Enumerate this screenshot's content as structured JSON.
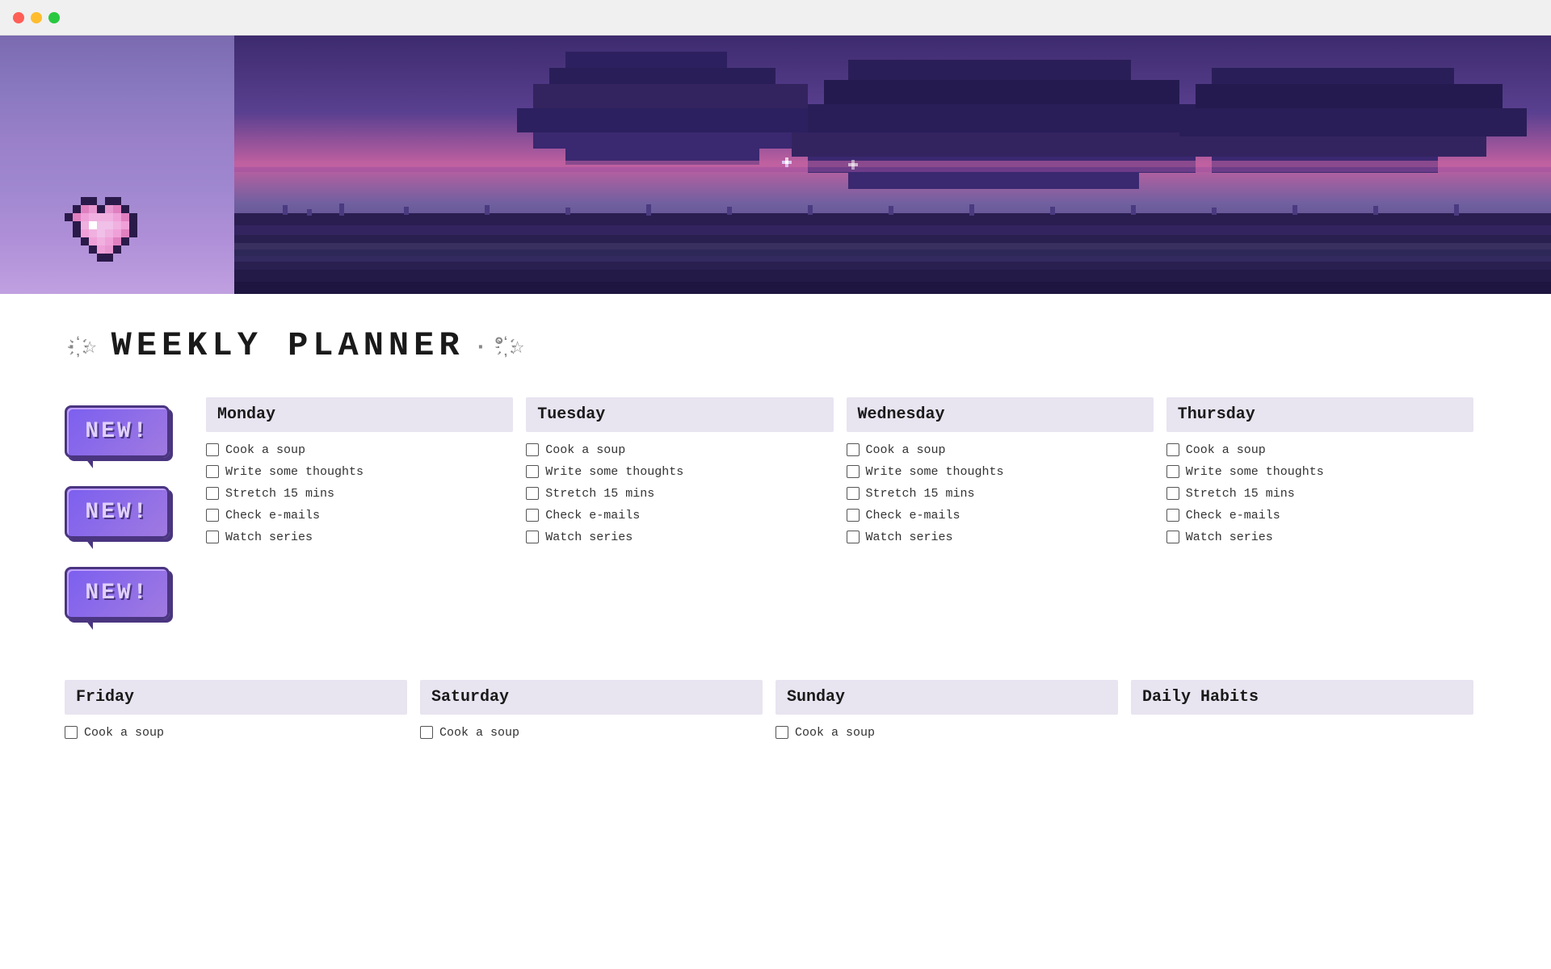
{
  "titleBar": {
    "buttons": [
      "close",
      "minimize",
      "maximize"
    ]
  },
  "pageTitle": {
    "prefix": "·҉☆",
    "main": "WEEKLY PLANNER",
    "suffix": "·°҉☆"
  },
  "newBadges": [
    {
      "label": "NEW!"
    },
    {
      "label": "NEW!"
    },
    {
      "label": "NEW!"
    }
  ],
  "days": [
    {
      "name": "Monday",
      "tasks": [
        "Cook a soup",
        "Write some thoughts",
        "Stretch 15 mins",
        "Check e-mails",
        "Watch series"
      ]
    },
    {
      "name": "Tuesday",
      "tasks": [
        "Cook a soup",
        "Write some thoughts",
        "Stretch 15 mins",
        "Check e-mails",
        "Watch series"
      ]
    },
    {
      "name": "Wednesday",
      "tasks": [
        "Cook a soup",
        "Write some thoughts",
        "Stretch 15 mins",
        "Check e-mails",
        "Watch series"
      ]
    },
    {
      "name": "Thursday",
      "tasks": [
        "Cook a soup",
        "Write some thoughts",
        "Stretch 15 mins",
        "Check e-mails",
        "Watch series"
      ]
    }
  ],
  "bottomDays": [
    {
      "name": "Friday",
      "tasks": [
        "Cook a soup"
      ]
    },
    {
      "name": "Saturday",
      "tasks": [
        "Cook a soup"
      ]
    },
    {
      "name": "Sunday",
      "tasks": [
        "Cook a soup"
      ]
    },
    {
      "name": "Daily Habits",
      "tasks": [
        ""
      ]
    }
  ],
  "colors": {
    "accent": "#7b5ff0",
    "headerBg": "#e8e4f0",
    "titleColor": "#1a1a1a"
  }
}
